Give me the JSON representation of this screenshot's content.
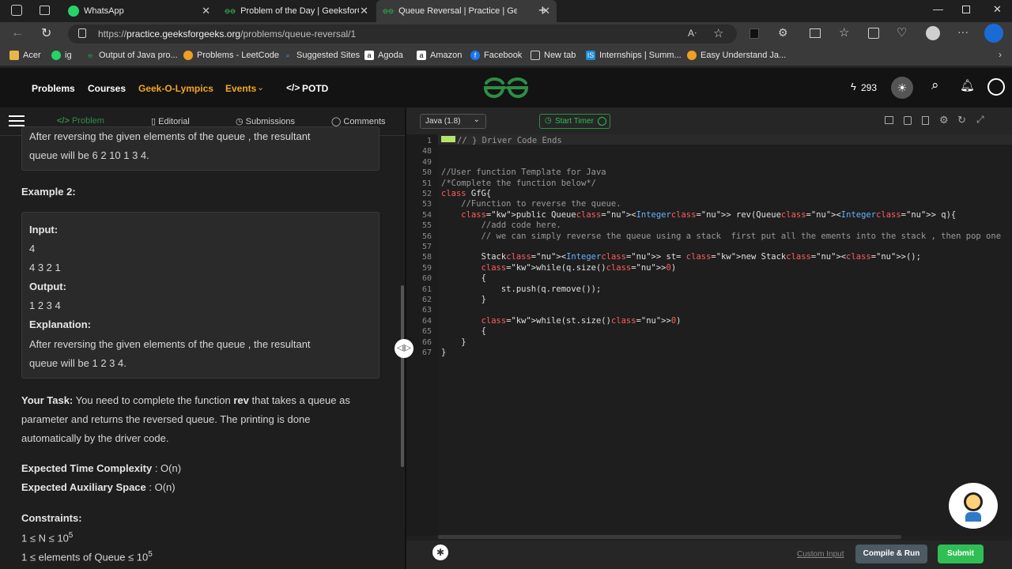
{
  "tabs": [
    {
      "label": "WhatsApp"
    },
    {
      "label": "Problem of the Day | GeeksforGe"
    },
    {
      "label": "Queue Reversal | Practice | Geek"
    }
  ],
  "address": {
    "url_prefix": "https://",
    "url_host": "practice.geeksforgeeks.org",
    "url_path": "/problems/queue-reversal/1"
  },
  "bookmarks": [
    "Acer",
    "ig",
    "Output of Java pro...",
    "Problems - LeetCode",
    "Suggested Sites",
    "Agoda",
    "Amazon",
    "Facebook",
    "New tab",
    "Internships | Summ...",
    "Easy Understand Ja..."
  ],
  "header": {
    "nav": [
      "Problems",
      "Courses",
      "Geek-O-Lympics",
      "Events",
      "POTD"
    ],
    "streak": "293"
  },
  "left_tabs": [
    "Problem",
    "Editorial",
    "Submissions",
    "Comments"
  ],
  "problem": {
    "ex1_tail_line1": "After reversing the given elements of the queue , the resultant",
    "ex1_tail_line2": "queue will be 6 2 10 1 3 4.",
    "example2_title": "Example 2:",
    "input_label": "Input:",
    "input_n": "4",
    "input_vals": "4 3 2 1",
    "output_label": "Output:",
    "output_vals": "1 2 3 4",
    "explanation_label": "Explanation:",
    "explanation_line1": "After reversing the given elements of the queue , the resultant",
    "explanation_line2": "queue will be 1 2 3 4.",
    "task_label": "Your Task:",
    "task_line1_a": " You need to complete the function ",
    "task_fn": "rev",
    "task_line1_b": " that takes a queue as",
    "task_line2": "parameter and returns the reversed queue. The printing is done",
    "task_line3": "automatically by the driver code.",
    "time_label": "Expected Time Complexity",
    "time_val": " : O(n)",
    "space_label": "Expected Auxiliary Space",
    "space_val": " : O(n)",
    "constraints_label": "Constraints:",
    "c1": "1 ≤ N ≤ 10",
    "c1_sup": "5",
    "c2": "1 ≤ elements of Queue ≤ 10",
    "c2_sup": "5"
  },
  "editor": {
    "language": "Java (1.8)",
    "start_timer": "Start Timer",
    "line_numbers": [
      "1",
      "48",
      "49",
      "50",
      "51",
      "52",
      "53",
      "54",
      "55",
      "56",
      "57",
      "58",
      "59",
      "60",
      "61",
      "62",
      "63",
      "64",
      "65",
      "66",
      "67"
    ],
    "lines": [
      "// } Driver Code Ends",
      "",
      "",
      "//User function Template for Java",
      "/*Complete the function below*/",
      "class GfG{",
      "    //Function to reverse the queue.",
      "    public Queue<Integer> rev(Queue<Integer> q){",
      "        //add code here.",
      "        // we can simply reverse the queue using a stack  first put all the ements into the stack , then pop one",
      "",
      "        Stack<Integer> st= new Stack<>();",
      "        while(q.size()>0)",
      "        {",
      "            st.push(q.remove());",
      "        }",
      "",
      "        while(st.size()>0)",
      "        {",
      "    }",
      "}"
    ],
    "custom_input": "Custom Input",
    "compile_run": "Compile & Run",
    "submit": "Submit"
  },
  "colors": {
    "gfg_green": "#2f8d46",
    "submit_green": "#2fbf55",
    "accent_orange": "#f5a623"
  }
}
